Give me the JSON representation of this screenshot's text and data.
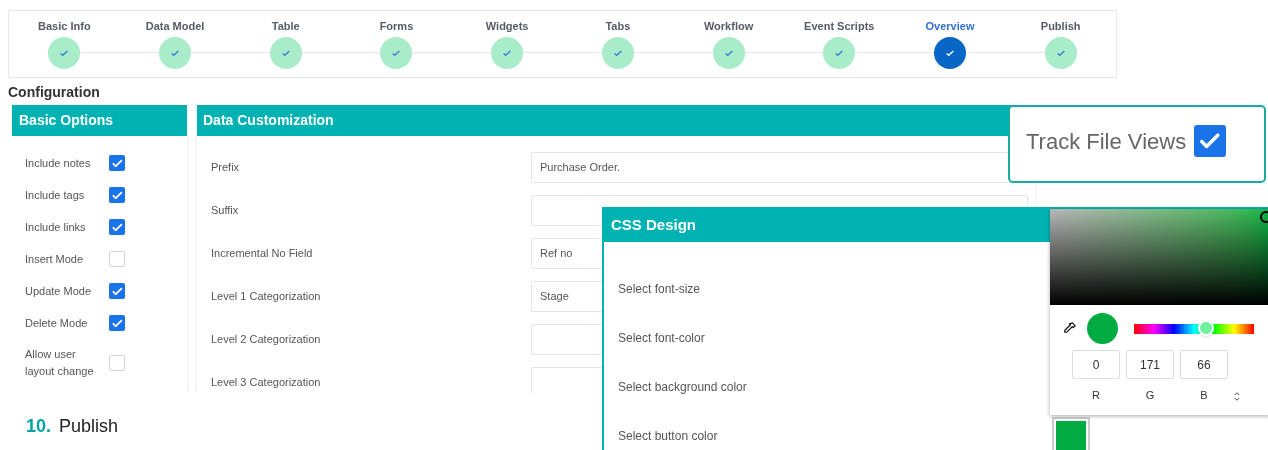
{
  "steps": [
    {
      "label": "Basic Info",
      "selected": false
    },
    {
      "label": "Data Model",
      "selected": false
    },
    {
      "label": "Table",
      "selected": false
    },
    {
      "label": "Forms",
      "selected": false
    },
    {
      "label": "Widgets",
      "selected": false
    },
    {
      "label": "Tabs",
      "selected": false
    },
    {
      "label": "Workflow",
      "selected": false
    },
    {
      "label": "Event Scripts",
      "selected": false
    },
    {
      "label": "Overview",
      "selected": true
    },
    {
      "label": "Publish",
      "selected": false
    }
  ],
  "section_title": "Configuration",
  "basic_options": {
    "title": "Basic Options",
    "items": [
      {
        "label": "Include notes",
        "checked": true
      },
      {
        "label": "Include tags",
        "checked": true
      },
      {
        "label": "Include links",
        "checked": true
      },
      {
        "label": "Insert Mode",
        "checked": false
      },
      {
        "label": "Update Mode",
        "checked": true
      },
      {
        "label": "Delete Mode",
        "checked": true
      },
      {
        "label": "Allow user layout change",
        "checked": false
      }
    ]
  },
  "data_customization": {
    "title": "Data Customization",
    "rows": [
      {
        "label": "Prefix",
        "value": "Purchase Order."
      },
      {
        "label": "Suffix"
      },
      {
        "label": "Incremental No Field",
        "value": "Ref no"
      },
      {
        "label": "Level 1 Categorization",
        "value": "Stage"
      },
      {
        "label": "Level 2 Categorization"
      },
      {
        "label": "Level 3 Categorization"
      }
    ]
  },
  "track_file_views": {
    "label": "Track File Views",
    "checked": true
  },
  "css_design": {
    "title": "CSS Design",
    "rows": [
      {
        "label": "Select font-size"
      },
      {
        "label": "Select font-color"
      },
      {
        "label": "Select background color"
      },
      {
        "label": "Select button color",
        "kind": "swatch"
      }
    ]
  },
  "color_picker": {
    "level": 0.6,
    "channels": [
      {
        "label": "R",
        "value": "0"
      },
      {
        "label": "G",
        "value": "171"
      },
      {
        "label": "B",
        "value": "66"
      }
    ]
  },
  "footer": {
    "number": "10.",
    "title": "Publish"
  }
}
